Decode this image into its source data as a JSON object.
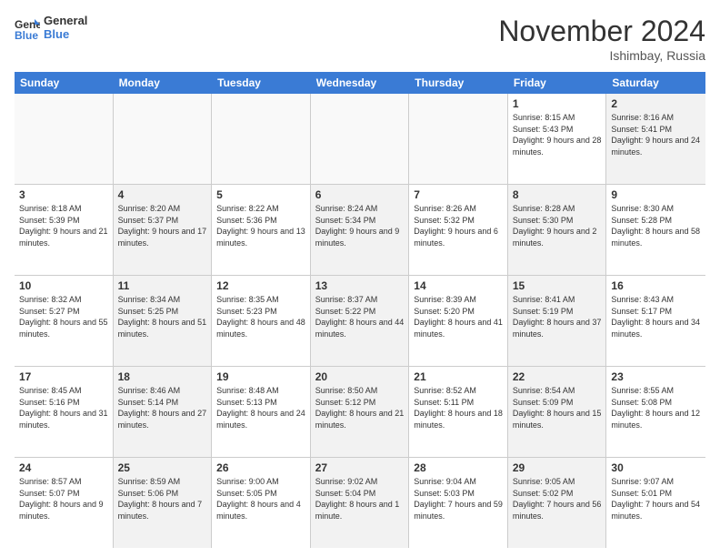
{
  "logo": {
    "text_general": "General",
    "text_blue": "Blue"
  },
  "header": {
    "title": "November 2024",
    "subtitle": "Ishimbay, Russia"
  },
  "weekdays": [
    "Sunday",
    "Monday",
    "Tuesday",
    "Wednesday",
    "Thursday",
    "Friday",
    "Saturday"
  ],
  "rows": [
    [
      {
        "day": "",
        "info": "",
        "empty": true
      },
      {
        "day": "",
        "info": "",
        "empty": true
      },
      {
        "day": "",
        "info": "",
        "empty": true
      },
      {
        "day": "",
        "info": "",
        "empty": true
      },
      {
        "day": "",
        "info": "",
        "empty": true
      },
      {
        "day": "1",
        "info": "Sunrise: 8:15 AM\nSunset: 5:43 PM\nDaylight: 9 hours and 28 minutes.",
        "empty": false,
        "alt": false
      },
      {
        "day": "2",
        "info": "Sunrise: 8:16 AM\nSunset: 5:41 PM\nDaylight: 9 hours and 24 minutes.",
        "empty": false,
        "alt": true
      }
    ],
    [
      {
        "day": "3",
        "info": "Sunrise: 8:18 AM\nSunset: 5:39 PM\nDaylight: 9 hours and 21 minutes.",
        "empty": false,
        "alt": false
      },
      {
        "day": "4",
        "info": "Sunrise: 8:20 AM\nSunset: 5:37 PM\nDaylight: 9 hours and 17 minutes.",
        "empty": false,
        "alt": true
      },
      {
        "day": "5",
        "info": "Sunrise: 8:22 AM\nSunset: 5:36 PM\nDaylight: 9 hours and 13 minutes.",
        "empty": false,
        "alt": false
      },
      {
        "day": "6",
        "info": "Sunrise: 8:24 AM\nSunset: 5:34 PM\nDaylight: 9 hours and 9 minutes.",
        "empty": false,
        "alt": true
      },
      {
        "day": "7",
        "info": "Sunrise: 8:26 AM\nSunset: 5:32 PM\nDaylight: 9 hours and 6 minutes.",
        "empty": false,
        "alt": false
      },
      {
        "day": "8",
        "info": "Sunrise: 8:28 AM\nSunset: 5:30 PM\nDaylight: 9 hours and 2 minutes.",
        "empty": false,
        "alt": true
      },
      {
        "day": "9",
        "info": "Sunrise: 8:30 AM\nSunset: 5:28 PM\nDaylight: 8 hours and 58 minutes.",
        "empty": false,
        "alt": false
      }
    ],
    [
      {
        "day": "10",
        "info": "Sunrise: 8:32 AM\nSunset: 5:27 PM\nDaylight: 8 hours and 55 minutes.",
        "empty": false,
        "alt": false
      },
      {
        "day": "11",
        "info": "Sunrise: 8:34 AM\nSunset: 5:25 PM\nDaylight: 8 hours and 51 minutes.",
        "empty": false,
        "alt": true
      },
      {
        "day": "12",
        "info": "Sunrise: 8:35 AM\nSunset: 5:23 PM\nDaylight: 8 hours and 48 minutes.",
        "empty": false,
        "alt": false
      },
      {
        "day": "13",
        "info": "Sunrise: 8:37 AM\nSunset: 5:22 PM\nDaylight: 8 hours and 44 minutes.",
        "empty": false,
        "alt": true
      },
      {
        "day": "14",
        "info": "Sunrise: 8:39 AM\nSunset: 5:20 PM\nDaylight: 8 hours and 41 minutes.",
        "empty": false,
        "alt": false
      },
      {
        "day": "15",
        "info": "Sunrise: 8:41 AM\nSunset: 5:19 PM\nDaylight: 8 hours and 37 minutes.",
        "empty": false,
        "alt": true
      },
      {
        "day": "16",
        "info": "Sunrise: 8:43 AM\nSunset: 5:17 PM\nDaylight: 8 hours and 34 minutes.",
        "empty": false,
        "alt": false
      }
    ],
    [
      {
        "day": "17",
        "info": "Sunrise: 8:45 AM\nSunset: 5:16 PM\nDaylight: 8 hours and 31 minutes.",
        "empty": false,
        "alt": false
      },
      {
        "day": "18",
        "info": "Sunrise: 8:46 AM\nSunset: 5:14 PM\nDaylight: 8 hours and 27 minutes.",
        "empty": false,
        "alt": true
      },
      {
        "day": "19",
        "info": "Sunrise: 8:48 AM\nSunset: 5:13 PM\nDaylight: 8 hours and 24 minutes.",
        "empty": false,
        "alt": false
      },
      {
        "day": "20",
        "info": "Sunrise: 8:50 AM\nSunset: 5:12 PM\nDaylight: 8 hours and 21 minutes.",
        "empty": false,
        "alt": true
      },
      {
        "day": "21",
        "info": "Sunrise: 8:52 AM\nSunset: 5:11 PM\nDaylight: 8 hours and 18 minutes.",
        "empty": false,
        "alt": false
      },
      {
        "day": "22",
        "info": "Sunrise: 8:54 AM\nSunset: 5:09 PM\nDaylight: 8 hours and 15 minutes.",
        "empty": false,
        "alt": true
      },
      {
        "day": "23",
        "info": "Sunrise: 8:55 AM\nSunset: 5:08 PM\nDaylight: 8 hours and 12 minutes.",
        "empty": false,
        "alt": false
      }
    ],
    [
      {
        "day": "24",
        "info": "Sunrise: 8:57 AM\nSunset: 5:07 PM\nDaylight: 8 hours and 9 minutes.",
        "empty": false,
        "alt": false
      },
      {
        "day": "25",
        "info": "Sunrise: 8:59 AM\nSunset: 5:06 PM\nDaylight: 8 hours and 7 minutes.",
        "empty": false,
        "alt": true
      },
      {
        "day": "26",
        "info": "Sunrise: 9:00 AM\nSunset: 5:05 PM\nDaylight: 8 hours and 4 minutes.",
        "empty": false,
        "alt": false
      },
      {
        "day": "27",
        "info": "Sunrise: 9:02 AM\nSunset: 5:04 PM\nDaylight: 8 hours and 1 minute.",
        "empty": false,
        "alt": true
      },
      {
        "day": "28",
        "info": "Sunrise: 9:04 AM\nSunset: 5:03 PM\nDaylight: 7 hours and 59 minutes.",
        "empty": false,
        "alt": false
      },
      {
        "day": "29",
        "info": "Sunrise: 9:05 AM\nSunset: 5:02 PM\nDaylight: 7 hours and 56 minutes.",
        "empty": false,
        "alt": true
      },
      {
        "day": "30",
        "info": "Sunrise: 9:07 AM\nSunset: 5:01 PM\nDaylight: 7 hours and 54 minutes.",
        "empty": false,
        "alt": false
      }
    ]
  ]
}
